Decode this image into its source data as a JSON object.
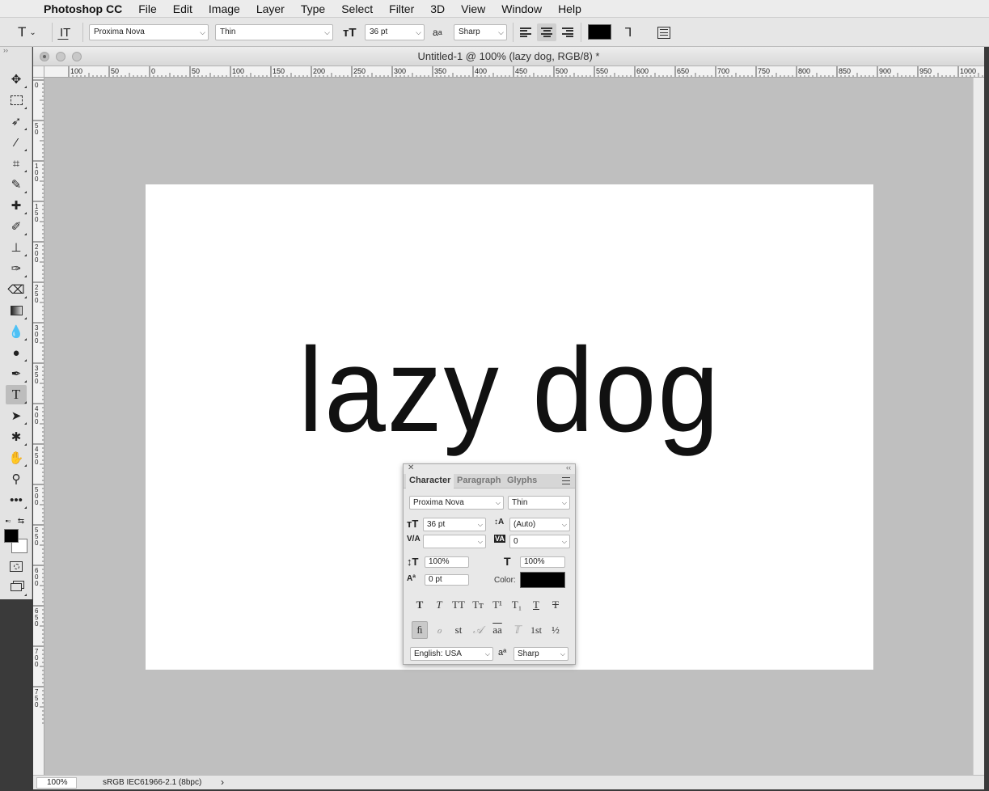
{
  "menubar": {
    "items": [
      "Photoshop CC",
      "File",
      "Edit",
      "Image",
      "Layer",
      "Type",
      "Select",
      "Filter",
      "3D",
      "View",
      "Window",
      "Help"
    ]
  },
  "options": {
    "font_family": "Proxima Nova",
    "font_style": "Thin",
    "font_size": "36 pt",
    "antialias": "Sharp",
    "color": "#000000"
  },
  "document": {
    "title": "Untitled-1 @ 100% (lazy dog, RGB/8) *",
    "canvas_text": "lazy dog",
    "ruler_h": [
      "100",
      "50",
      "0",
      "50",
      "100",
      "150",
      "200",
      "250",
      "300",
      "350",
      "400",
      "450",
      "500",
      "550",
      "600",
      "650",
      "700",
      "750",
      "800",
      "850",
      "900",
      "950",
      "1000"
    ],
    "ruler_v": [
      "0",
      "5 0",
      "1 0 0",
      "1 5 0",
      "2 0 0",
      "2 5 0",
      "3 0 0",
      "3 5 0",
      "4 0 0",
      "4 5 0",
      "5 0 0",
      "5 5 0",
      "6 0 0",
      "6 5 0",
      "7 0 0",
      "7 5 0"
    ]
  },
  "status": {
    "zoom": "100%",
    "profile": "sRGB IEC61966-2.1 (8bpc)"
  },
  "character": {
    "tabs": [
      "Character",
      "Paragraph",
      "Glyphs"
    ],
    "font_family": "Proxima Nova",
    "font_style": "Thin",
    "size": "36 pt",
    "leading": "(Auto)",
    "kerning": "",
    "tracking": "0",
    "vscale": "100%",
    "hscale": "100%",
    "baseline": "0 pt",
    "color_label": "Color:",
    "language": "English: USA",
    "antialias": "Sharp",
    "style_buttons": [
      "T",
      "T",
      "TT",
      "Tт",
      "T¹",
      "T₁",
      "T",
      "T"
    ],
    "opentype_buttons": [
      "ﬁ",
      "ℴ",
      "st",
      "𝒜",
      "aa",
      "𝕋",
      "1st",
      "½"
    ]
  }
}
